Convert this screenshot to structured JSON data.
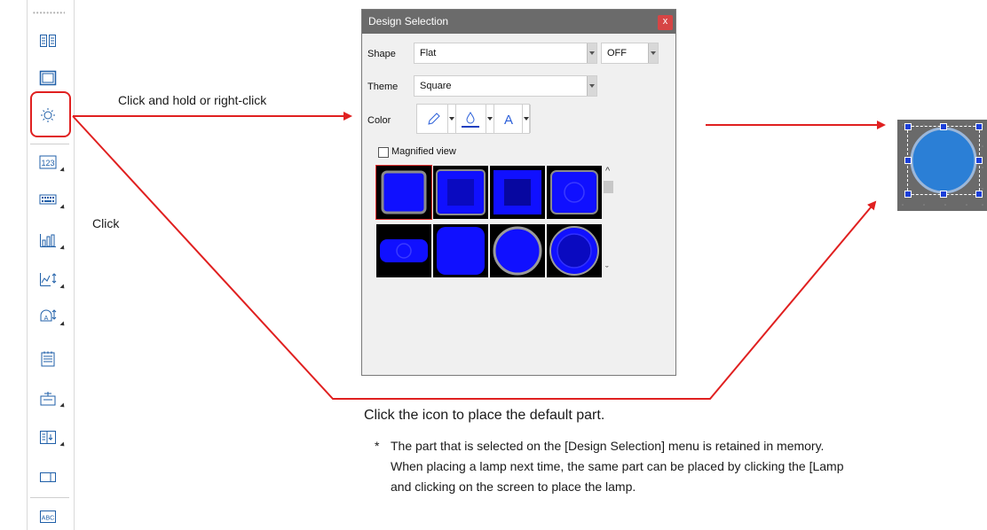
{
  "toolbar": {
    "buttons": [
      {
        "name": "multi-display-icon",
        "has_dropdown": false
      },
      {
        "name": "window-icon",
        "has_dropdown": false
      },
      {
        "name": "lamp-icon",
        "has_dropdown": false
      },
      {
        "name": "numeric-display-icon",
        "has_dropdown": true
      },
      {
        "name": "keypad-icon",
        "has_dropdown": true
      },
      {
        "name": "bar-graph-icon",
        "has_dropdown": true
      },
      {
        "name": "trend-graph-icon",
        "has_dropdown": true
      },
      {
        "name": "alarm-icon",
        "has_dropdown": true
      },
      {
        "name": "table-data-icon",
        "has_dropdown": false
      },
      {
        "name": "message-display-icon",
        "has_dropdown": true
      },
      {
        "name": "sample-display-icon",
        "has_dropdown": true
      },
      {
        "name": "entry-target-icon",
        "has_dropdown": false
      },
      {
        "name": "abc-char-display-icon",
        "has_dropdown": false
      }
    ],
    "highlight_color": "#e02020"
  },
  "annotations": {
    "hold_text": "Click and hold or right-click",
    "click_text": "Click",
    "place_text": "Click the icon to place the default part.",
    "note_marker": "*",
    "note_line1": "The part that is selected on the [Design Selection] menu is retained in memory.",
    "note_line2": "When placing a lamp next time, the same part can be placed by clicking the [Lamp",
    "note_line3": "and clicking on the screen to place the lamp.",
    "arrow_color": "#e02020"
  },
  "dialog": {
    "title": "Design Selection",
    "close_label": "x",
    "shape_label": "Shape",
    "shape_value": "Flat",
    "shape_option_value": "OFF",
    "theme_label": "Theme",
    "theme_value": "Square",
    "color_label": "Color",
    "magnified_label": "Magnified view",
    "magnified_checked": false,
    "scroll_up": "^",
    "scroll_down": "ˇ",
    "parts": [
      {
        "name": "part-square-flat-1",
        "selected": true
      },
      {
        "name": "part-square-inset",
        "selected": false
      },
      {
        "name": "part-square-dark-center",
        "selected": false
      },
      {
        "name": "part-square-ring",
        "selected": false
      },
      {
        "name": "part-oval-button",
        "selected": false
      },
      {
        "name": "part-rounded-square",
        "selected": false
      },
      {
        "name": "part-circle-ring",
        "selected": false
      },
      {
        "name": "part-circle-double-ring",
        "selected": false
      }
    ],
    "part_fill": "#1010ff",
    "accent": "#2b5fd9"
  },
  "preview": {
    "lamp_color": "#2b7fd6",
    "handle_color": "#1b3fd8"
  }
}
